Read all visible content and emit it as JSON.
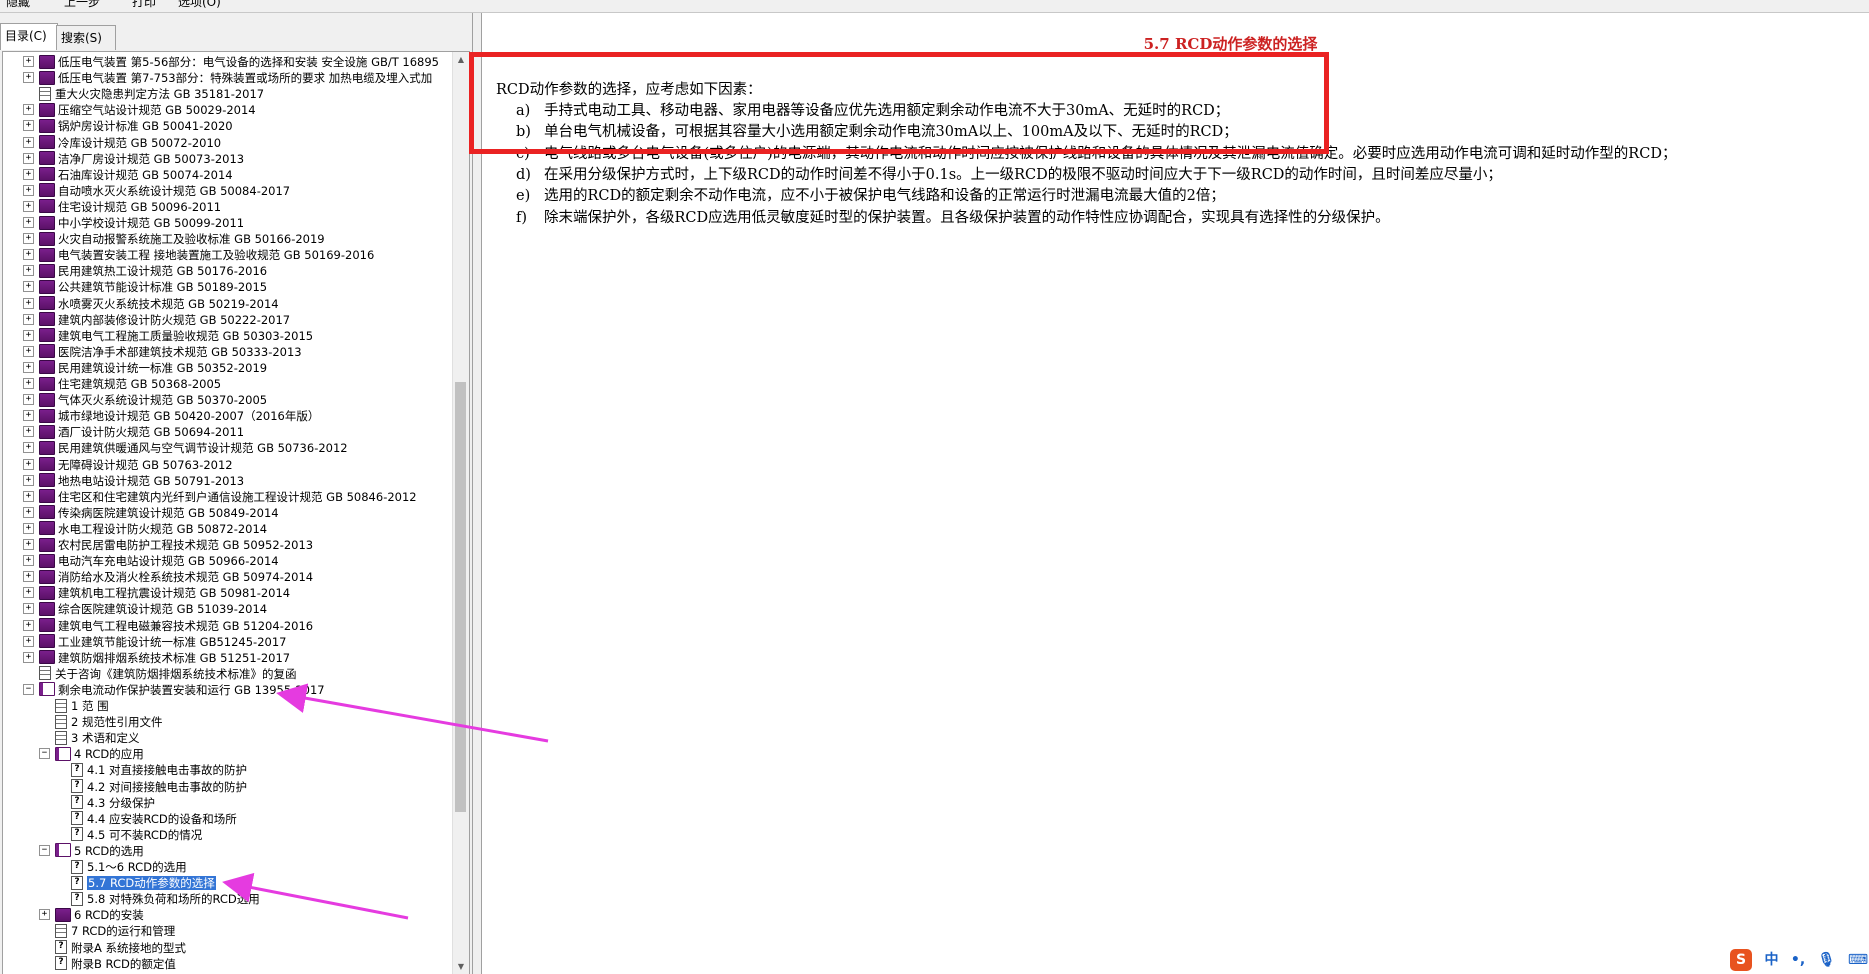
{
  "toolbar": {
    "items": [
      "隐藏",
      "上一步",
      "打印",
      "选项(O)"
    ]
  },
  "tabs": [
    {
      "label": "目录(C)",
      "active": true
    },
    {
      "label": "搜索(S)",
      "active": false
    }
  ],
  "tree": [
    {
      "level": 0,
      "expander": "+",
      "icon": "book",
      "label": "低压电气装置 第5-56部分：电气设备的选择和安装 安全设施 GB/T 16895"
    },
    {
      "level": 0,
      "expander": "+",
      "icon": "book",
      "label": "低压电气装置 第7-753部分：特殊装置或场所的要求 加热电缆及埋入式加"
    },
    {
      "level": 0,
      "expander": "",
      "icon": "doc",
      "label": "重大火灾隐患判定方法 GB 35181-2017"
    },
    {
      "level": 0,
      "expander": "+",
      "icon": "book",
      "label": "压缩空气站设计规范 GB 50029-2014"
    },
    {
      "level": 0,
      "expander": "+",
      "icon": "book",
      "label": "锅炉房设计标准 GB 50041-2020"
    },
    {
      "level": 0,
      "expander": "+",
      "icon": "book",
      "label": "冷库设计规范 GB 50072-2010"
    },
    {
      "level": 0,
      "expander": "+",
      "icon": "book",
      "label": "洁净厂房设计规范 GB 50073-2013"
    },
    {
      "level": 0,
      "expander": "+",
      "icon": "book",
      "label": "石油库设计规范 GB 50074-2014"
    },
    {
      "level": 0,
      "expander": "+",
      "icon": "book",
      "label": "自动喷水灭火系统设计规范 GB 50084-2017"
    },
    {
      "level": 0,
      "expander": "+",
      "icon": "book",
      "label": "住宅设计规范 GB 50096-2011"
    },
    {
      "level": 0,
      "expander": "+",
      "icon": "book",
      "label": "中小学校设计规范 GB 50099-2011"
    },
    {
      "level": 0,
      "expander": "+",
      "icon": "book",
      "label": "火灾自动报警系统施工及验收标准 GB 50166-2019"
    },
    {
      "level": 0,
      "expander": "+",
      "icon": "book",
      "label": "电气装置安装工程 接地装置施工及验收规范 GB 50169-2016"
    },
    {
      "level": 0,
      "expander": "+",
      "icon": "book",
      "label": "民用建筑热工设计规范 GB 50176-2016"
    },
    {
      "level": 0,
      "expander": "+",
      "icon": "book",
      "label": "公共建筑节能设计标准 GB 50189-2015"
    },
    {
      "level": 0,
      "expander": "+",
      "icon": "book",
      "label": "水喷雾灭火系统技术规范 GB 50219-2014"
    },
    {
      "level": 0,
      "expander": "+",
      "icon": "book",
      "label": "建筑内部装修设计防火规范 GB 50222-2017"
    },
    {
      "level": 0,
      "expander": "+",
      "icon": "book",
      "label": "建筑电气工程施工质量验收规范 GB 50303-2015"
    },
    {
      "level": 0,
      "expander": "+",
      "icon": "book",
      "label": "医院洁净手术部建筑技术规范 GB 50333-2013"
    },
    {
      "level": 0,
      "expander": "+",
      "icon": "book",
      "label": "民用建筑设计统一标准 GB 50352-2019"
    },
    {
      "level": 0,
      "expander": "+",
      "icon": "book",
      "label": "住宅建筑规范 GB 50368-2005"
    },
    {
      "level": 0,
      "expander": "+",
      "icon": "book",
      "label": "气体灭火系统设计规范 GB 50370-2005"
    },
    {
      "level": 0,
      "expander": "+",
      "icon": "book",
      "label": "城市绿地设计规范 GB 50420-2007（2016年版）"
    },
    {
      "level": 0,
      "expander": "+",
      "icon": "book",
      "label": "酒厂设计防火规范 GB 50694-2011"
    },
    {
      "level": 0,
      "expander": "+",
      "icon": "book",
      "label": "民用建筑供暖通风与空气调节设计规范 GB 50736-2012"
    },
    {
      "level": 0,
      "expander": "+",
      "icon": "book",
      "label": "无障碍设计规范 GB 50763-2012"
    },
    {
      "level": 0,
      "expander": "+",
      "icon": "book",
      "label": "地热电站设计规范 GB 50791-2013"
    },
    {
      "level": 0,
      "expander": "+",
      "icon": "book",
      "label": "住宅区和住宅建筑内光纤到户通信设施工程设计规范 GB 50846-2012"
    },
    {
      "level": 0,
      "expander": "+",
      "icon": "book",
      "label": "传染病医院建筑设计规范 GB 50849-2014"
    },
    {
      "level": 0,
      "expander": "+",
      "icon": "book",
      "label": "水电工程设计防火规范 GB 50872-2014"
    },
    {
      "level": 0,
      "expander": "+",
      "icon": "book",
      "label": "农村民居雷电防护工程技术规范 GB 50952-2013"
    },
    {
      "level": 0,
      "expander": "+",
      "icon": "book",
      "label": "电动汽车充电站设计规范 GB 50966-2014"
    },
    {
      "level": 0,
      "expander": "+",
      "icon": "book",
      "label": "消防给水及消火栓系统技术规范 GB 50974-2014"
    },
    {
      "level": 0,
      "expander": "+",
      "icon": "book",
      "label": "建筑机电工程抗震设计规范 GB 50981-2014"
    },
    {
      "level": 0,
      "expander": "+",
      "icon": "book",
      "label": "综合医院建筑设计规范 GB 51039-2014"
    },
    {
      "level": 0,
      "expander": "+",
      "icon": "book",
      "label": "建筑电气工程电磁兼容技术规范 GB 51204-2016"
    },
    {
      "level": 0,
      "expander": "+",
      "icon": "book",
      "label": "工业建筑节能设计统一标准 GB51245-2017"
    },
    {
      "level": 0,
      "expander": "+",
      "icon": "book",
      "label": "建筑防烟排烟系统技术标准 GB 51251-2017"
    },
    {
      "level": 0,
      "expander": "",
      "icon": "doc",
      "label": "关于咨询《建筑防烟排烟系统技术标准》的复函"
    },
    {
      "level": 0,
      "expander": "−",
      "icon": "openbook",
      "label": "剩余电流动作保护装置安装和运行 GB 13955-2017"
    },
    {
      "level": 1,
      "expander": "",
      "icon": "doc",
      "label": "1 范 围"
    },
    {
      "level": 1,
      "expander": "",
      "icon": "doc",
      "label": "2 规范性引用文件"
    },
    {
      "level": 1,
      "expander": "",
      "icon": "doc",
      "label": "3 术语和定义"
    },
    {
      "level": 1,
      "expander": "−",
      "icon": "openbook",
      "label": "4 RCD的应用"
    },
    {
      "level": 2,
      "expander": "",
      "icon": "qdoc",
      "label": "4.1 对直接接触电击事故的防护"
    },
    {
      "level": 2,
      "expander": "",
      "icon": "qdoc",
      "label": "4.2 对间接接触电击事故的防护"
    },
    {
      "level": 2,
      "expander": "",
      "icon": "qdoc",
      "label": "4.3 分级保护"
    },
    {
      "level": 2,
      "expander": "",
      "icon": "qdoc",
      "label": "4.4 应安装RCD的设备和场所"
    },
    {
      "level": 2,
      "expander": "",
      "icon": "qdoc",
      "label": "4.5 可不装RCD的情况"
    },
    {
      "level": 1,
      "expander": "−",
      "icon": "openbook",
      "label": "5 RCD的选用"
    },
    {
      "level": 2,
      "expander": "",
      "icon": "qdoc",
      "label": "5.1～6 RCD的选用"
    },
    {
      "level": 2,
      "expander": "",
      "icon": "qdoc",
      "label": "5.7 RCD动作参数的选择",
      "selected": true
    },
    {
      "level": 2,
      "expander": "",
      "icon": "qdoc",
      "label": "5.8 对特殊负荷和场所的RCD选用"
    },
    {
      "level": 1,
      "expander": "+",
      "icon": "book",
      "label": "6 RCD的安装"
    },
    {
      "level": 1,
      "expander": "",
      "icon": "doc",
      "label": "7 RCD的运行和管理"
    },
    {
      "level": 1,
      "expander": "",
      "icon": "qdoc",
      "label": "附录A 系统接地的型式"
    },
    {
      "level": 1,
      "expander": "",
      "icon": "qdoc",
      "label": "附录B RCD的额定值"
    }
  ],
  "content": {
    "heading": "5.7 RCD动作参数的选择",
    "intro": "RCD动作参数的选择，应考虑如下因素：",
    "items": [
      {
        "letter": "a)",
        "text": "手持式电动工具、移动电器、家用电器等设备应优先选用额定剩余动作电流不大于30mA、无延时的RCD；"
      },
      {
        "letter": "b)",
        "text": "单台电气机械设备，可根据其容量大小选用额定剩余动作电流30mA以上、100mA及以下、无延时的RCD；"
      },
      {
        "letter": "c)",
        "text": "电气线路或多台电气设备(或多住户)的电源端，其动作电流和动作时间应按被保护线路和设备的具体情况及其泄漏电流值确定。必要时应选用动作电流可调和延时动作型的RCD；"
      },
      {
        "letter": "d)",
        "text": "在采用分级保护方式时，上下级RCD的动作时间差不得小于0.1s。上一级RCD的极限不驱动时间应大于下一级RCD的动作时间，且时间差应尽量小；"
      },
      {
        "letter": "e)",
        "text": "选用的RCD的额定剩余不动作电流，应不小于被保护电气线路和设备的正常运行时泄漏电流最大值的2倍；"
      },
      {
        "letter": "f)",
        "text": "除末端保护外，各级RCD应选用低灵敏度延时型的保护装置。且各级保护装置的动作特性应协调配合，实现具有选择性的分级保护。"
      }
    ]
  },
  "ime": {
    "logo": "S",
    "lang": "中",
    "punct": "•,",
    "mic": "🎙",
    "kbd": "⌨"
  },
  "colors": {
    "highlight": "#ea2222",
    "arrow": "#e53be0",
    "heading": "#cc2222",
    "selection": "#3375d6"
  }
}
